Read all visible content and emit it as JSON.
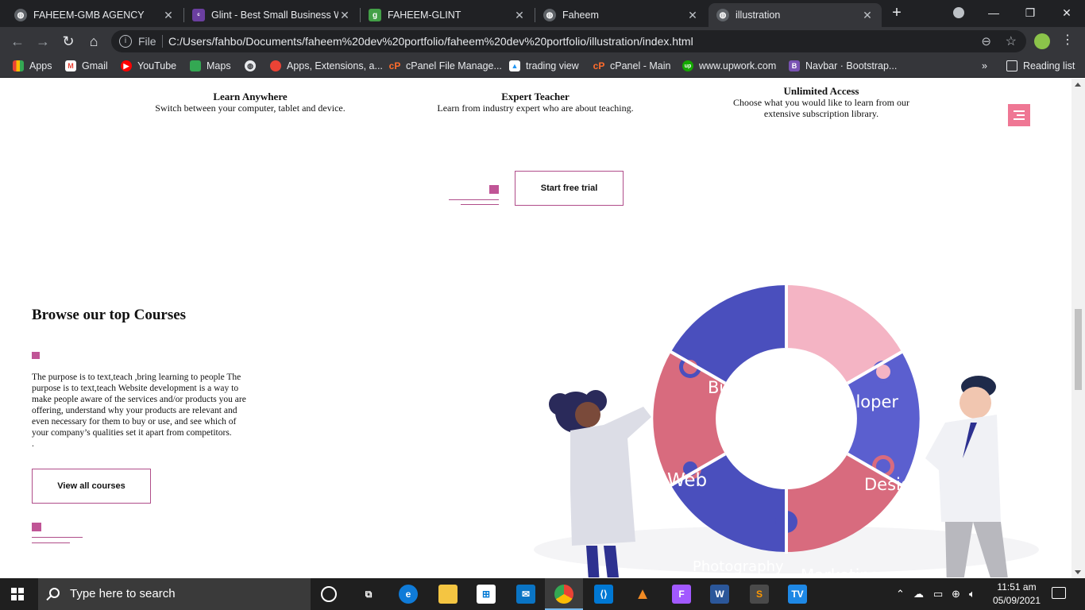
{
  "browser": {
    "tabs": [
      {
        "title": "FAHEEM-GMB AGENCY",
        "favicon": "globe-icon"
      },
      {
        "title": "Glint - Best Small Business W",
        "favicon": "colorlib-icon"
      },
      {
        "title": "FAHEEM-GLINT",
        "favicon": "g-icon"
      },
      {
        "title": "Faheem",
        "favicon": "globe-icon"
      },
      {
        "title": "illustration",
        "favicon": "globe-icon",
        "active": true
      }
    ],
    "address": {
      "scheme": "File",
      "url": "C:/Users/fahbo/Documents/faheem%20dev%20portfolio/faheem%20dev%20portfolio/illustration/index.html"
    },
    "bookmarks": [
      {
        "label": "Apps",
        "icon": "apps-grid-icon"
      },
      {
        "label": "Gmail",
        "icon": "gmail-icon"
      },
      {
        "label": "YouTube",
        "icon": "youtube-icon"
      },
      {
        "label": "Maps",
        "icon": "maps-icon"
      },
      {
        "label": "",
        "icon": "globe-icon"
      },
      {
        "label": "Apps, Extensions, a...",
        "icon": "extensions-icon"
      },
      {
        "label": "cPanel File Manage...",
        "icon": "cpanel-icon"
      },
      {
        "label": "trading view",
        "icon": "tradingview-icon"
      },
      {
        "label": "cPanel - Main",
        "icon": "cpanel-icon"
      },
      {
        "label": "www.upwork.com",
        "icon": "upwork-icon"
      },
      {
        "label": "Navbar · Bootstrap...",
        "icon": "bootstrap-icon"
      }
    ],
    "more_bookmarks": "»",
    "reading_list": "Reading list"
  },
  "page": {
    "features": [
      {
        "title": "Learn Anywhere",
        "text": "Switch between your computer, tablet and device."
      },
      {
        "title": "Expert Teacher",
        "text": "Learn from industry expert who are about teaching."
      },
      {
        "title": "Unlimited Access",
        "text": "Choose what you would like to learn from our extensive subscription library."
      }
    ],
    "trial_button": "Start free trial",
    "courses": {
      "title": "Browse our top Courses",
      "text": "The purpose is to text,teach ,bring learning to people The purpose is to text,teach Website development is a way to make people aware of the services and/or products you are offering, understand why your products are relevant and even necessary for them to buy or use, and see which of your company’s qualities set it apart from competitors.",
      "trailing": ".",
      "button": "View all courses"
    },
    "puzzle_labels": [
      "Business",
      "Developer",
      "Design",
      "Marketing",
      "Photography",
      "Web"
    ],
    "colors": {
      "accent": "#b04d8a",
      "hamburger": "#ef7794",
      "blue": "#4a4fbd",
      "pink": "#f4b4c4",
      "rose": "#d86b7e"
    }
  },
  "taskbar": {
    "search_placeholder": "Type here to search",
    "time": "11:51 am",
    "date": "05/09/2021"
  }
}
